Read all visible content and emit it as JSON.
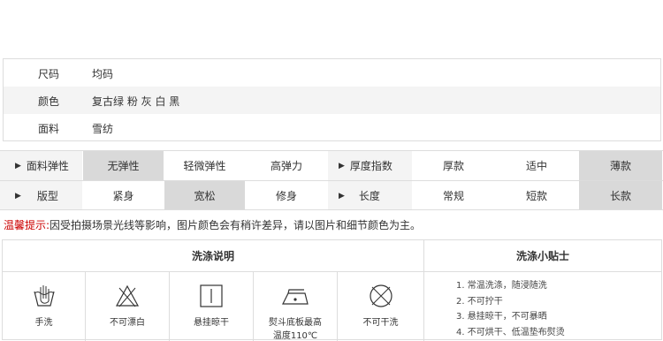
{
  "info": {
    "rows": [
      {
        "key": "尺码",
        "value": "均码"
      },
      {
        "key": "颜色",
        "value": "复古绿 粉 灰 白 黑"
      },
      {
        "key": "面料",
        "value": "雪纺"
      }
    ]
  },
  "attributes": {
    "row1": {
      "label": "面料弹性",
      "options": [
        "无弹性",
        "轻微弹性",
        "高弹力"
      ],
      "selected": 0,
      "label2": "厚度指数",
      "options2": [
        "厚款",
        "适中",
        "薄款"
      ],
      "selected2": 2
    },
    "row2": {
      "label": "版型",
      "options": [
        "紧身",
        "宽松",
        "修身"
      ],
      "selected": 1,
      "label2": "长度",
      "options2": [
        "常规",
        "短款",
        "长款"
      ],
      "selected2": 2
    }
  },
  "notice": {
    "prefix": "温馨提示:",
    "text": "因受拍摄场景光线等影响，图片颜色会有稍许差异，请以图片和细节颜色为主。"
  },
  "wash": {
    "header_left": "洗涤说明",
    "header_right": "洗涤小贴士",
    "icons": [
      {
        "icon": "hand-wash-icon",
        "label": "手洗"
      },
      {
        "icon": "no-bleach-icon",
        "label": "不可漂白"
      },
      {
        "icon": "hang-dry-icon",
        "label": "悬挂晾干"
      },
      {
        "icon": "iron-icon",
        "label": "熨斗底板最高",
        "label2": "温度110℃"
      },
      {
        "icon": "no-dry-clean-icon",
        "label": "不可干洗"
      }
    ],
    "tips": [
      "1. 常温洗涤，随浸随洗",
      "2. 不可拧干",
      "3. 悬挂晾干，不可暴晒",
      "4. 不可烘干、低温垫布熨烫"
    ]
  }
}
